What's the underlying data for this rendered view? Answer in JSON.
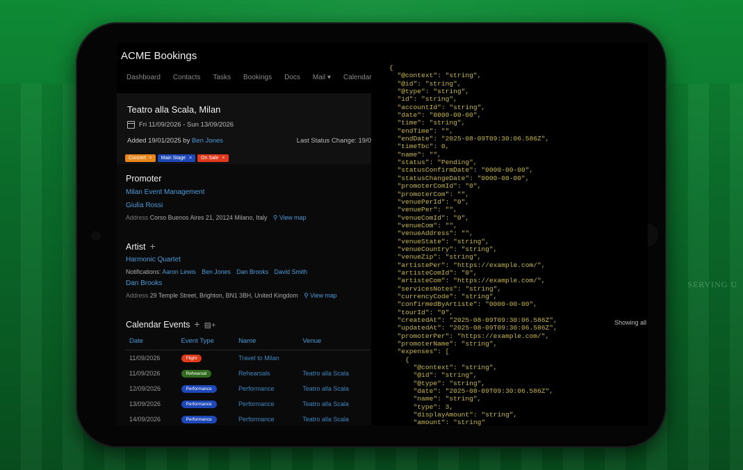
{
  "app": {
    "title": "ACME Bookings"
  },
  "nav": [
    "Dashboard",
    "Contacts",
    "Tasks",
    "Bookings",
    "Docs",
    "Mail ▾",
    "Calendar"
  ],
  "booking": {
    "venue": "Teatro alla Scala, Milan",
    "dates": "Fri 11/09/2026 - Sun 13/09/2026",
    "added_prefix": "Added 19/01/2025 by",
    "added_by": "Ben Jones",
    "status_change": "Last Status Change: 19/0",
    "tags": [
      {
        "label": "Concert",
        "color": "#e8861c"
      },
      {
        "label": "Main Stage",
        "color": "#1e48b8"
      },
      {
        "label": "On Sale",
        "color": "#e0391c"
      }
    ],
    "tag_remove_glyph": "×"
  },
  "promoter": {
    "heading": "Promoter",
    "company": "Milan Event Management",
    "contact": "Giulia Rossi",
    "address_label": "Address",
    "address": "Corso Buenos Aires 21, 20124 Milano, Italy",
    "map_link": "View map"
  },
  "artist": {
    "heading": "Artist",
    "name": "Harmonic Quartet",
    "notifications_label": "Notifications:",
    "notifications": [
      "Aaron Lewis",
      "Ben Jones",
      "Dan Brooks",
      "David Smith"
    ],
    "contact": "Dan Brooks",
    "address_label": "Address",
    "address": "29 Temple Street, Brighton, BN1 3BH, United Kingdom",
    "map_link": "View map"
  },
  "calendar_events": {
    "heading": "Calendar Events",
    "showing": "Showing all",
    "columns": [
      "Date",
      "Event Type",
      "Name",
      "Venue"
    ],
    "rows": [
      {
        "date": "11/09/2026",
        "type": "Flight",
        "type_color": "#e0391c",
        "name": "Travel to Milan",
        "venue": ""
      },
      {
        "date": "11/09/2026",
        "type": "Rehearsal",
        "type_color": "#2f6a1f",
        "name": "Rehearsals",
        "venue": "Teatro alla Scala"
      },
      {
        "date": "12/09/2026",
        "type": "Performance",
        "type_color": "#1e48b8",
        "name": "Performance",
        "venue": "Teatro alla Scala"
      },
      {
        "date": "13/09/2026",
        "type": "Performance",
        "type_color": "#1e48b8",
        "name": "Performance",
        "venue": "Teatro alla Scala"
      },
      {
        "date": "14/09/2026",
        "type": "Performance",
        "type_color": "#1e48b8",
        "name": "Performance",
        "venue": "Teatro alla Scala"
      }
    ]
  },
  "json_lines": [
    "{",
    "  \"@context\": \"string\",",
    "  \"@id\": \"string\",",
    "  \"@type\": \"string\",",
    "  \"id\": \"string\",",
    "  \"accountId\": \"string\",",
    "  \"date\": \"0000-00-00\",",
    "  \"time\": \"string\",",
    "  \"endTime\": \"\",",
    "  \"endDate\": \"2025-08-09T09:30:06.586Z\",",
    "  \"timeTbc\": 0,",
    "  \"name\": \"\",",
    "  \"status\": \"Pending\",",
    "  \"statusConfirmDate\": \"0000-00-00\",",
    "  \"statusChangeDate\": \"0000-00-00\",",
    "  \"promoterComId\": \"0\",",
    "  \"promoterCom\": \"\",",
    "  \"venuePerId\": \"0\",",
    "  \"venuePer\": \"\",",
    "  \"venueComId\": \"0\",",
    "  \"venueCom\": \"\",",
    "  \"venueAddress\": \"\",",
    "  \"venueState\": \"string\",",
    "  \"venueCountry\": \"string\",",
    "  \"venueZip\": \"string\",",
    "  \"artistePer\": \"https://example.com/\",",
    "  \"artisteComId\": \"0\",",
    "  \"artisteCom\": \"https://example.com/\",",
    "  \"servicesNotes\": \"string\",",
    "  \"currencyCode\": \"string\",",
    "  \"confirmedByArtiste\": \"0000-00-00\",",
    "  \"tourId\": \"0\",",
    "  \"createdAt\": \"2025-08-09T09:30:06.586Z\",",
    "  \"updatedAt\": \"2025-08-09T09:30:06.586Z\",",
    "  \"promoterPer\": \"https://example.com/\",",
    "  \"promoterName\": \"string\",",
    "  \"expenses\": [",
    "    {",
    "      \"@context\": \"string\",",
    "      \"@id\": \"string\",",
    "      \"@type\": \"string\",",
    "      \"date\": \"2025-08-09T09:30:06.586Z\",",
    "      \"name\": \"string\",",
    "      \"type\": 3,",
    "      \"displayAmount\": \"string\",",
    "      \"amount\": \"string\""
  ],
  "background": {
    "sign_text": "SERVING U"
  },
  "colors": {
    "link": "#4a9bd8",
    "json": "#c9b84a",
    "background_green": "#0f8a35"
  }
}
